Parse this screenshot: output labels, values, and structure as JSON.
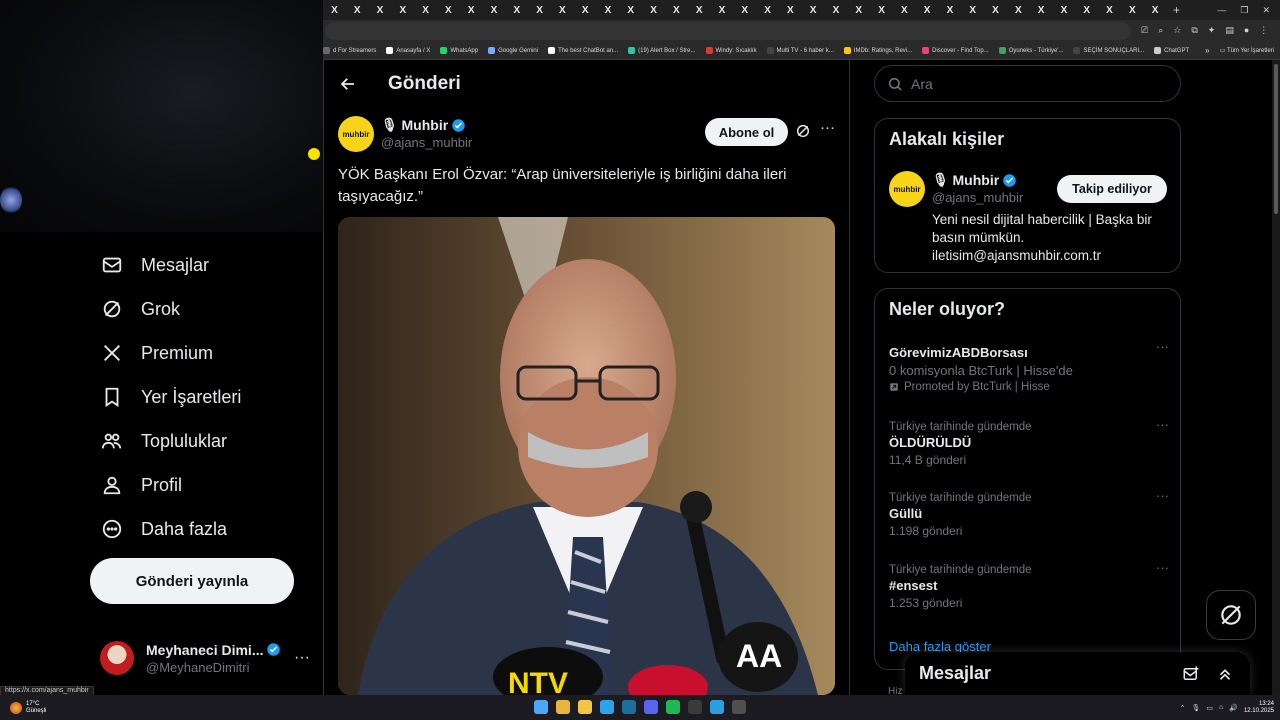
{
  "browser": {
    "tab_count": 37,
    "tab_icon_glyph": "X",
    "new_tab_glyph": "+",
    "bookmarks": [
      {
        "label": "d For Streamers",
        "color": "#6a6a6a"
      },
      {
        "label": "Anasayfa / X",
        "color": "#ffffff"
      },
      {
        "label": "WhatsApp",
        "color": "#25d366"
      },
      {
        "label": "Google Gemini",
        "color": "#7aa7ff"
      },
      {
        "label": "The best ChatBot an...",
        "color": "#ffffff"
      },
      {
        "label": "(19) Alert Box / Stre...",
        "color": "#31c3a2"
      },
      {
        "label": "Windy: Sıcaklık",
        "color": "#d83a3a"
      },
      {
        "label": "Multi TV - 6 haber k...",
        "color": "#444444"
      },
      {
        "label": "IMDb: Ratings, Revi...",
        "color": "#f5c518"
      },
      {
        "label": "Discover - Find Top...",
        "color": "#e8437b"
      },
      {
        "label": "Oyuneks - Türkiye'...",
        "color": "#3aa55d"
      },
      {
        "label": "SEÇİM SONUÇLARI...",
        "color": "#444444"
      },
      {
        "label": "ChatGPT",
        "color": "#cccccc"
      }
    ],
    "bookmarks_overflow": "»",
    "all_bookmarks": "Tüm Yer İşaretleri",
    "status_url": "https://x.com/ajans_muhbir"
  },
  "sidebar": {
    "items": [
      {
        "label": "Mesajlar",
        "icon": "envelope-icon"
      },
      {
        "label": "Grok",
        "icon": "grok-icon"
      },
      {
        "label": "Premium",
        "icon": "x-logo-icon"
      },
      {
        "label": "Yer İşaretleri",
        "icon": "bookmark-icon"
      },
      {
        "label": "Topluluklar",
        "icon": "communities-icon"
      },
      {
        "label": "Profil",
        "icon": "person-icon"
      },
      {
        "label": "Daha fazla",
        "icon": "more-circle-icon"
      }
    ],
    "post_button": "Gönderi yayınla",
    "account": {
      "name": "Meyhaneci Dimi...",
      "handle": "@MeyhaneDimitri",
      "more": "···",
      "avatar_caption": "DİMİTRİ"
    }
  },
  "main": {
    "page_title": "Gönderi",
    "tweet": {
      "author_name": "Muhbir",
      "author_handle": "@ajans_muhbir",
      "avatar_text": "muhbir",
      "subscribe_label": "Abone ol",
      "more": "···",
      "text": "YÖK Başkanı Erol Özvar: “Arap üniversiteleriyle iş birliğini daha ileri taşıyacağız.”",
      "media_logos": [
        "NTV",
        "AA"
      ]
    }
  },
  "right": {
    "search_placeholder": "Ara",
    "related": {
      "title": "Alakalı kişiler",
      "name": "Muhbir",
      "handle": "@ajans_muhbir",
      "avatar_text": "muhbir",
      "follow_label": "Takip ediliyor",
      "bio": "Yeni nesil dijital habercilik | Başka bir basın mümkün. iletisim@ajansmuhbir.com.tr"
    },
    "trends": {
      "title": "Neler oluyor?",
      "promoted": {
        "name": "GörevimizABDBorsası",
        "description": "0 komisyonla BtcTurk | Hisse'de",
        "promo_label": "Promoted by BtcTurk | Hisse"
      },
      "items": [
        {
          "context": "Türkiye tarihinde gündemde",
          "name": "ÖLDÜRÜLDÜ",
          "count": "11,4 B gönderi"
        },
        {
          "context": "Türkiye tarihinde gündemde",
          "name": "Güllü",
          "count": "1.198 gönderi"
        },
        {
          "context": "Türkiye tarihinde gündemde",
          "name": "#ensest",
          "count": "1.253 gönderi"
        }
      ],
      "more": "···",
      "show_more": "Daha fazla göster"
    },
    "footer_peek": "Hiz"
  },
  "messages_drawer": {
    "title": "Mesajlar"
  },
  "taskbar": {
    "weather_temp": "17°C",
    "weather_text": "Güneşli",
    "time": "13:24",
    "date": "12.10.2025",
    "icons": [
      {
        "name": "windows-start-icon",
        "color": "#4aa8ff"
      },
      {
        "name": "chrome-icon",
        "color": "#e8b53d"
      },
      {
        "name": "file-explorer-icon",
        "color": "#f3c544"
      },
      {
        "name": "edge-icon",
        "color": "#2ea3e8"
      },
      {
        "name": "steam-icon",
        "color": "#1b6f9a"
      },
      {
        "name": "discord-icon",
        "color": "#5865f2"
      },
      {
        "name": "spotify-icon",
        "color": "#1db954"
      },
      {
        "name": "kick-icon",
        "color": "#3a3a3a"
      },
      {
        "name": "telegram-icon",
        "color": "#2aa0e0"
      },
      {
        "name": "obs-icon",
        "color": "#505050"
      }
    ]
  },
  "colors": {
    "accent_blue": "#1d9bf0",
    "muhbir_yellow": "#f7d417",
    "background": "#000000",
    "border": "#2f3336"
  }
}
